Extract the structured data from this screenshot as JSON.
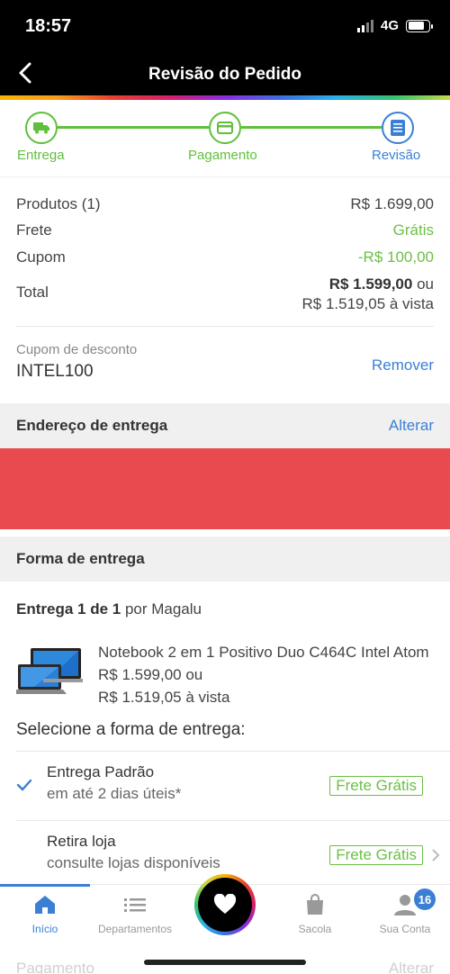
{
  "status": {
    "time": "18:57",
    "network": "4G"
  },
  "nav": {
    "title": "Revisão do Pedido"
  },
  "stepper": {
    "steps": [
      {
        "label": "Entrega"
      },
      {
        "label": "Pagamento"
      },
      {
        "label": "Revisão"
      }
    ]
  },
  "summary": {
    "products_label": "Produtos (1)",
    "products_value": "R$ 1.699,00",
    "shipping_label": "Frete",
    "shipping_value": "Grátis",
    "coupon_label": "Cupom",
    "coupon_value": "-R$ 100,00",
    "total_label": "Total",
    "total_value": "R$ 1.599,00",
    "total_suffix": "ou",
    "total_cash": "R$ 1.519,05 à vista"
  },
  "coupon": {
    "label": "Cupom de desconto",
    "code": "INTEL100",
    "remove": "Remover"
  },
  "address": {
    "title": "Endereço de entrega",
    "action": "Alterar"
  },
  "delivery": {
    "title": "Forma de entrega",
    "shipment_bold": "Entrega 1 de 1",
    "shipment_rest": " por Magalu",
    "product": {
      "name": "Notebook 2 em 1 Positivo Duo C464C Intel Atom",
      "price": "R$ 1.599,00 ou",
      "cash": "R$ 1.519,05 à vista"
    },
    "select_title": "Selecione a forma de entrega:",
    "options": [
      {
        "name": "Entrega Padrão",
        "sub": "em até 2 dias úteis*",
        "badge": "Frete Grátis"
      },
      {
        "name": "Retira loja",
        "sub": "consulte lojas disponíveis",
        "badge": "Frete Grátis"
      }
    ]
  },
  "ghost": {
    "payment": "Pagamento",
    "change": "Alterar"
  },
  "tabbar": {
    "tabs": [
      {
        "label": "Início",
        "icon": "home-icon"
      },
      {
        "label": "Departamentos",
        "icon": "list-icon"
      },
      {
        "label": "Sacola",
        "icon": "bag-icon"
      },
      {
        "label": "Sua Conta",
        "icon": "user-icon"
      }
    ],
    "badge": "16"
  },
  "colors": {
    "green": "#6cbf46",
    "blue": "#3b7fd5",
    "red": "#e84a4f"
  }
}
